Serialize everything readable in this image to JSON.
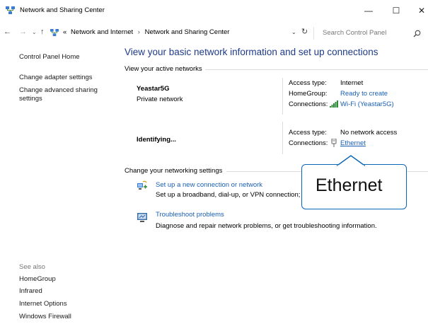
{
  "window": {
    "title": "Network and Sharing Center",
    "minimize_glyph": "—",
    "maximize_glyph": "☐",
    "close_glyph": "✕"
  },
  "address": {
    "back_glyph": "←",
    "forward_glyph": "→",
    "recent_glyph": "⌄",
    "up_glyph": "↑",
    "crumb_prefix": "«",
    "crumbs": [
      "Network and Internet",
      "Network and Sharing Center"
    ],
    "crumb_separator": "›",
    "dropdown_glyph": "⌄",
    "refresh_glyph": "↻",
    "search_placeholder": "Search Control Panel"
  },
  "sidebar": {
    "home": "Control Panel Home",
    "adapter": "Change adapter settings",
    "sharing_line1": "Change advanced sharing",
    "sharing_line2": "settings",
    "see_also_label": "See also",
    "see_also": [
      "HomeGroup",
      "Infrared",
      "Internet Options",
      "Windows Firewall"
    ]
  },
  "main": {
    "heading": "View your basic network information and set up connections",
    "active_networks_label": "View your active networks",
    "networks": [
      {
        "name": "Yeastar5G",
        "type": "Private network",
        "access_type_label": "Access type:",
        "access_type": "Internet",
        "homegroup_label": "HomeGroup:",
        "homegroup": "Ready to create",
        "connections_label": "Connections:",
        "connection": "Wi-Fi (Yeastar5G)"
      },
      {
        "name": "Identifying...",
        "access_type_label": "Access type:",
        "access_type": "No network access",
        "connections_label": "Connections:",
        "connection": "Ethernet"
      }
    ],
    "change_settings_label": "Change your networking settings",
    "tasks": [
      {
        "title": "Set up a new connection or network",
        "description": "Set up a broadband, dial-up, or VPN connection; o"
      },
      {
        "title": "Troubleshoot problems",
        "description": "Diagnose and repair network problems, or get troubleshooting information."
      }
    ]
  },
  "callout": {
    "text": "Ethernet",
    "border_color": "#0a66b7"
  },
  "colors": {
    "heading": "#1e3a8a",
    "link": "#1a5fb4"
  }
}
